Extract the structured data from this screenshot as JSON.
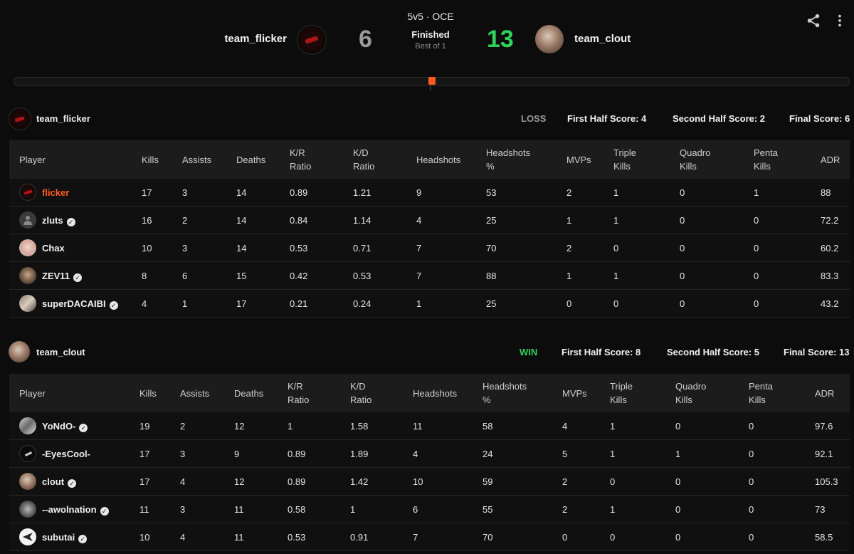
{
  "match": {
    "mode": "5v5 · OCE",
    "status": "Finished",
    "best_of": "Best of 1",
    "team1": {
      "name": "team_flicker",
      "score": "6"
    },
    "team2": {
      "name": "team_clout",
      "score": "13"
    }
  },
  "timeline": {
    "marker_position": 0.5
  },
  "icons": {
    "share": "share-icon",
    "more": "more-vertical-icon"
  },
  "colors": {
    "accent": "#ff5a1f",
    "win": "#2fd35c",
    "loss": "#9a9a9a"
  },
  "columns": [
    [
      "Player"
    ],
    [
      "Kills"
    ],
    [
      "Assists"
    ],
    [
      "Deaths"
    ],
    [
      "K/R",
      "Ratio"
    ],
    [
      "K/D",
      "Ratio"
    ],
    [
      "Headshots"
    ],
    [
      "Headshots",
      "%"
    ],
    [
      "MVPs"
    ],
    [
      "Triple",
      "Kills"
    ],
    [
      "Quadro",
      "Kills"
    ],
    [
      "Penta",
      "Kills"
    ],
    [
      "ADR"
    ]
  ],
  "teams": [
    {
      "name": "team_flicker",
      "result": "LOSS",
      "first_half": "First Half Score: 4",
      "second_half": "Second Half Score: 2",
      "final": "Final Score: 6",
      "players": [
        {
          "name": "flicker",
          "verified": false,
          "highlight": true,
          "avatar": "flicker",
          "stats": [
            "17",
            "3",
            "14",
            "0.89",
            "1.21",
            "9",
            "53",
            "2",
            "1",
            "0",
            "1",
            "88"
          ]
        },
        {
          "name": "zluts",
          "verified": true,
          "avatar": "default",
          "stats": [
            "16",
            "2",
            "14",
            "0.84",
            "1.14",
            "4",
            "25",
            "1",
            "1",
            "0",
            "0",
            "72.2"
          ]
        },
        {
          "name": "Chax",
          "verified": false,
          "avatar": "chax",
          "stats": [
            "10",
            "3",
            "14",
            "0.53",
            "0.71",
            "7",
            "70",
            "2",
            "0",
            "0",
            "0",
            "60.2"
          ]
        },
        {
          "name": "ZEV11",
          "verified": true,
          "avatar": "zev",
          "stats": [
            "8",
            "6",
            "15",
            "0.42",
            "0.53",
            "7",
            "88",
            "1",
            "1",
            "0",
            "0",
            "83.3"
          ]
        },
        {
          "name": "superDACAIBI",
          "verified": true,
          "avatar": "super",
          "stats": [
            "4",
            "1",
            "17",
            "0.21",
            "0.24",
            "1",
            "25",
            "0",
            "0",
            "0",
            "0",
            "43.2"
          ]
        }
      ]
    },
    {
      "name": "team_clout",
      "result": "WIN",
      "first_half": "First Half Score: 8",
      "second_half": "Second Half Score: 5",
      "final": "Final Score: 13",
      "players": [
        {
          "name": "YoNdO-",
          "verified": true,
          "avatar": "yondo",
          "stats": [
            "19",
            "2",
            "12",
            "1",
            "1.58",
            "11",
            "58",
            "4",
            "1",
            "0",
            "0",
            "97.6"
          ]
        },
        {
          "name": "-EyesCool-",
          "verified": false,
          "avatar": "eyes",
          "stats": [
            "17",
            "3",
            "9",
            "0.89",
            "1.89",
            "4",
            "24",
            "5",
            "1",
            "1",
            "0",
            "92.1"
          ]
        },
        {
          "name": "clout",
          "verified": true,
          "avatar": "clout",
          "stats": [
            "17",
            "4",
            "12",
            "0.89",
            "1.42",
            "10",
            "59",
            "2",
            "0",
            "0",
            "0",
            "105.3"
          ]
        },
        {
          "name": "--awolnation",
          "verified": true,
          "avatar": "awol",
          "stats": [
            "11",
            "3",
            "11",
            "0.58",
            "1",
            "6",
            "55",
            "2",
            "1",
            "0",
            "0",
            "73"
          ]
        },
        {
          "name": "subutai",
          "verified": true,
          "avatar": "subutai",
          "stats": [
            "10",
            "4",
            "11",
            "0.53",
            "0.91",
            "7",
            "70",
            "0",
            "0",
            "0",
            "0",
            "58.5"
          ]
        }
      ]
    }
  ]
}
